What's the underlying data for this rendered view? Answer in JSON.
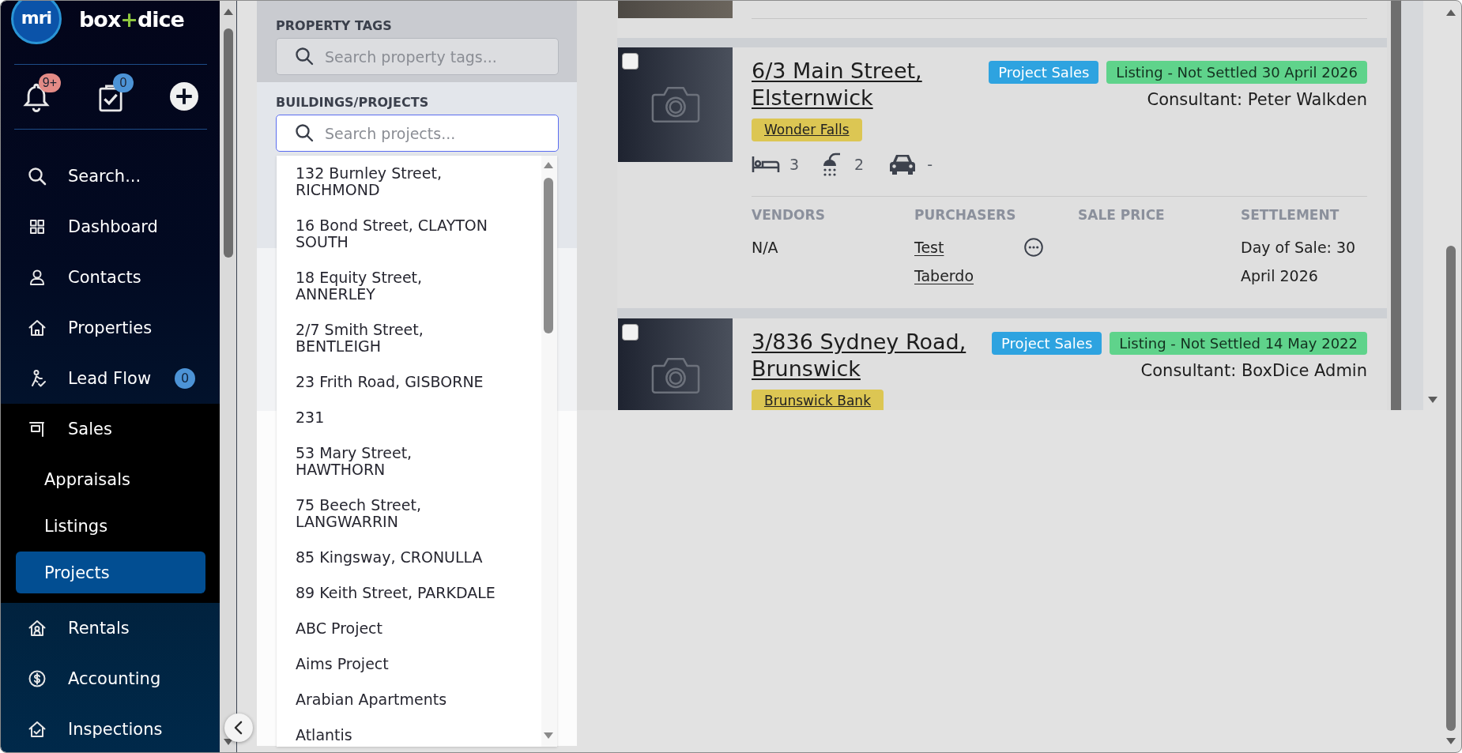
{
  "sidebar": {
    "brand": {
      "mark": "mri",
      "name": [
        {
          "text": "box",
          "color": "#ffffff"
        },
        {
          "text": "+",
          "color": "#8dc63f"
        },
        {
          "text": "dice",
          "color": "#ffffff"
        }
      ]
    },
    "actions": [
      {
        "kind": "bell",
        "badge": "9+",
        "color": "#e38b86"
      },
      {
        "kind": "tasks",
        "badge": "0",
        "color": "#4c93d6"
      },
      {
        "kind": "add"
      }
    ],
    "nav": [
      {
        "label": "Search...",
        "selected": false
      },
      {
        "label": "Dashboard",
        "selected": false
      },
      {
        "label": "Contacts",
        "selected": false
      },
      {
        "label": "Properties",
        "selected": false
      },
      {
        "label": "Lead Flow",
        "badge": "0",
        "selected": false
      },
      {
        "label": "Sales",
        "selected": false,
        "expanded": true,
        "children": [
          {
            "label": "Appraisals",
            "selected": false
          },
          {
            "label": "Listings",
            "selected": false
          },
          {
            "label": "Projects",
            "selected": true
          }
        ]
      },
      {
        "label": "Rentals",
        "selected": false
      },
      {
        "label": "Accounting",
        "selected": false
      },
      {
        "label": "Inspections",
        "selected": false
      }
    ]
  },
  "filters": [
    {
      "label": "PROPERTY TAGS",
      "placeholder": "Search property tags...",
      "focused": false
    },
    {
      "label": "BUILDINGS/PROJECTS",
      "placeholder": "Search projects...",
      "focused": true,
      "options": [
        "132 Burnley Street, RICHMOND",
        "16 Bond Street, CLAYTON SOUTH",
        "18 Equity Street, ANNERLEY",
        "2/7 Smith Street, BENTLEIGH",
        "23 Frith Road, GISBORNE",
        "231",
        "53 Mary Street, HAWTHORN",
        "75 Beech Street, LANGWARRIN",
        "85 Kingsway, CRONULLA",
        "89 Keith Street, PARKDALE",
        "ABC Project",
        "Aims Project",
        "Arabian Apartments",
        "Atlantis"
      ]
    }
  ],
  "listings": [
    {
      "kind": "stub"
    },
    {
      "kind": "listing",
      "checked": false,
      "title": "6/3 Main Street, Elsternwick",
      "badges": [
        {
          "label": "Project Sales",
          "color": "#2ea3e0"
        },
        {
          "label": "Listing - Not Settled 30 April 2026",
          "color": "#5fd38b"
        }
      ],
      "consultant": "Consultant: Peter Walkden",
      "tag": "Wonder Falls",
      "features": [
        {
          "kind": "bed",
          "value": "3"
        },
        {
          "kind": "bath",
          "value": "2"
        },
        {
          "kind": "car",
          "value": "-"
        }
      ],
      "details": [
        {
          "heading": "VENDORS",
          "kind": "text",
          "value": "N/A"
        },
        {
          "heading": "PURCHASERS",
          "kind": "link",
          "value": "Test Taberdo",
          "more": true
        },
        {
          "heading": "SALE PRICE"
        },
        {
          "heading": "SETTLEMENT",
          "kind": "text",
          "value": "Day of Sale: 30 April 2026"
        }
      ]
    },
    {
      "kind": "listing",
      "checked": false,
      "title": "3/836 Sydney Road, Brunswick",
      "badges": [
        {
          "label": "Project Sales",
          "color": "#2ea3e0"
        },
        {
          "label": "Listing - Not Settled 14 May 2022",
          "color": "#5fd38b"
        }
      ],
      "consultant": "Consultant: BoxDice Admin",
      "tag": "Brunswick Bank"
    }
  ]
}
